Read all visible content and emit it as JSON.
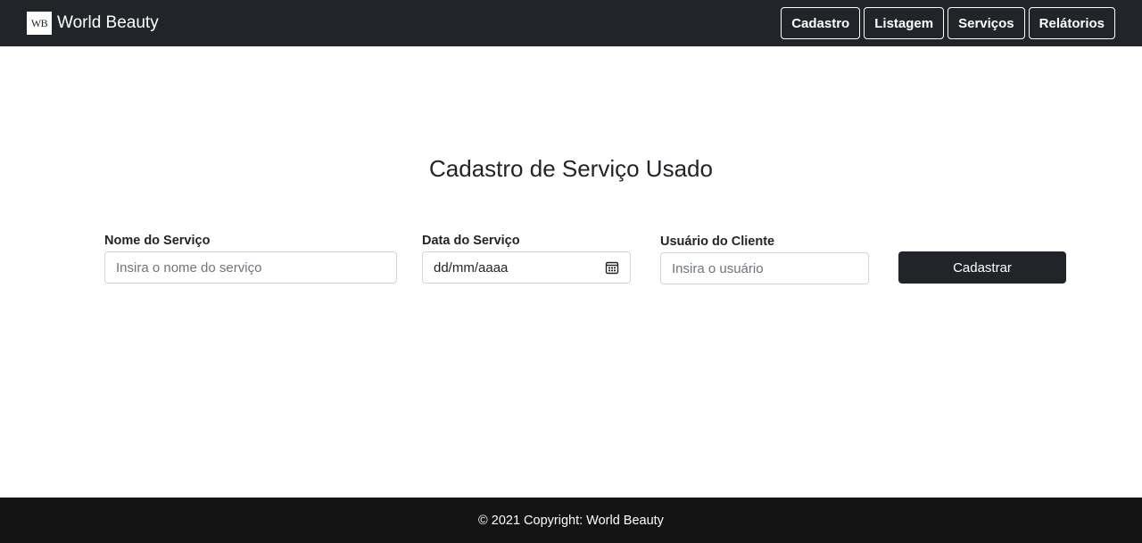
{
  "navbar": {
    "logo_text": "WB",
    "brand_name": "World Beauty",
    "buttons": [
      "Cadastro",
      "Listagem",
      "Serviços",
      "Relátorios"
    ]
  },
  "form": {
    "title": "Cadastro de Serviço Usado",
    "service_name": {
      "label": "Nome do Serviço",
      "placeholder": "Insira o nome do serviço"
    },
    "service_date": {
      "label": "Data do Serviço",
      "placeholder": "dd/mm/aaaa"
    },
    "client_user": {
      "label": "Usuário do Cliente",
      "placeholder": "Insira o usuário"
    },
    "submit_label": "Cadastrar"
  },
  "footer": {
    "text": "© 2021 Copyright: World Beauty"
  },
  "colors": {
    "navbar_bg": "#212529",
    "footer_bg": "#141414",
    "button_dark": "#212529"
  },
  "icons": {
    "date_picker": "calendar-icon"
  }
}
